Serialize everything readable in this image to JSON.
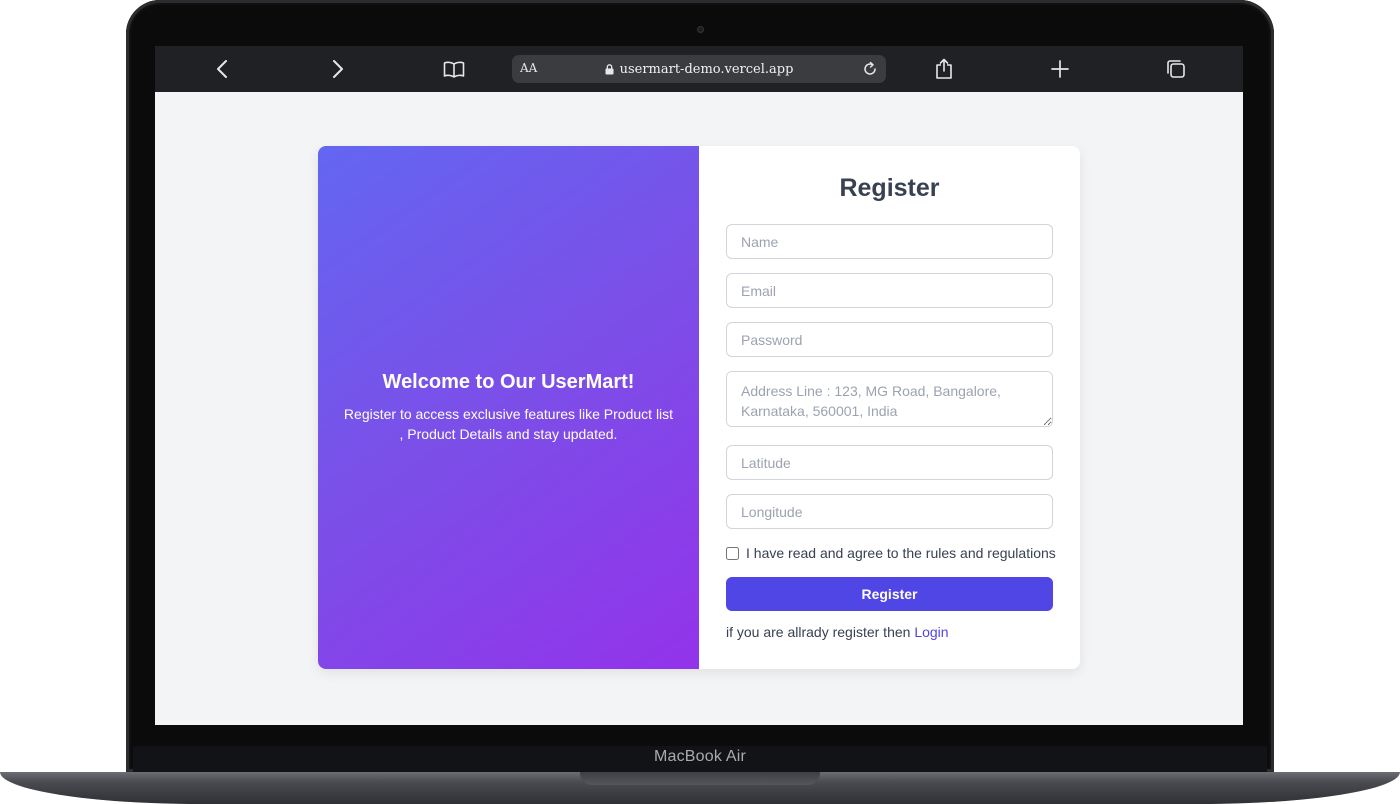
{
  "device": {
    "label": "MacBook Air"
  },
  "browser": {
    "text_size_label": "AA",
    "url": "usermart-demo.vercel.app",
    "icons": [
      "back-icon",
      "forward-icon",
      "bookmarks-icon",
      "lock-icon",
      "reload-icon",
      "share-icon",
      "new-tab-icon",
      "tabs-icon"
    ]
  },
  "welcome": {
    "title": "Welcome to Our UserMart!",
    "subtitle": "Register to access exclusive features like Product list , Product Details and stay updated."
  },
  "form": {
    "title": "Register",
    "name_placeholder": "Name",
    "email_placeholder": "Email",
    "password_placeholder": "Password",
    "address_placeholder": "Address Line : 123, MG Road, Bangalore, Karnataka, 560001, India",
    "latitude_placeholder": "Latitude",
    "longitude_placeholder": "Longitude",
    "agree_label": "I have read and agree to the rules and regulations",
    "agree_checked": false,
    "submit_label": "Register",
    "login_prompt": "if you are allrady register then",
    "login_link": "Login"
  },
  "colors": {
    "accent": "#4f46e5",
    "gradient_start": "#6366f1",
    "gradient_end": "#9333ea",
    "page_bg": "#f3f4f6"
  }
}
